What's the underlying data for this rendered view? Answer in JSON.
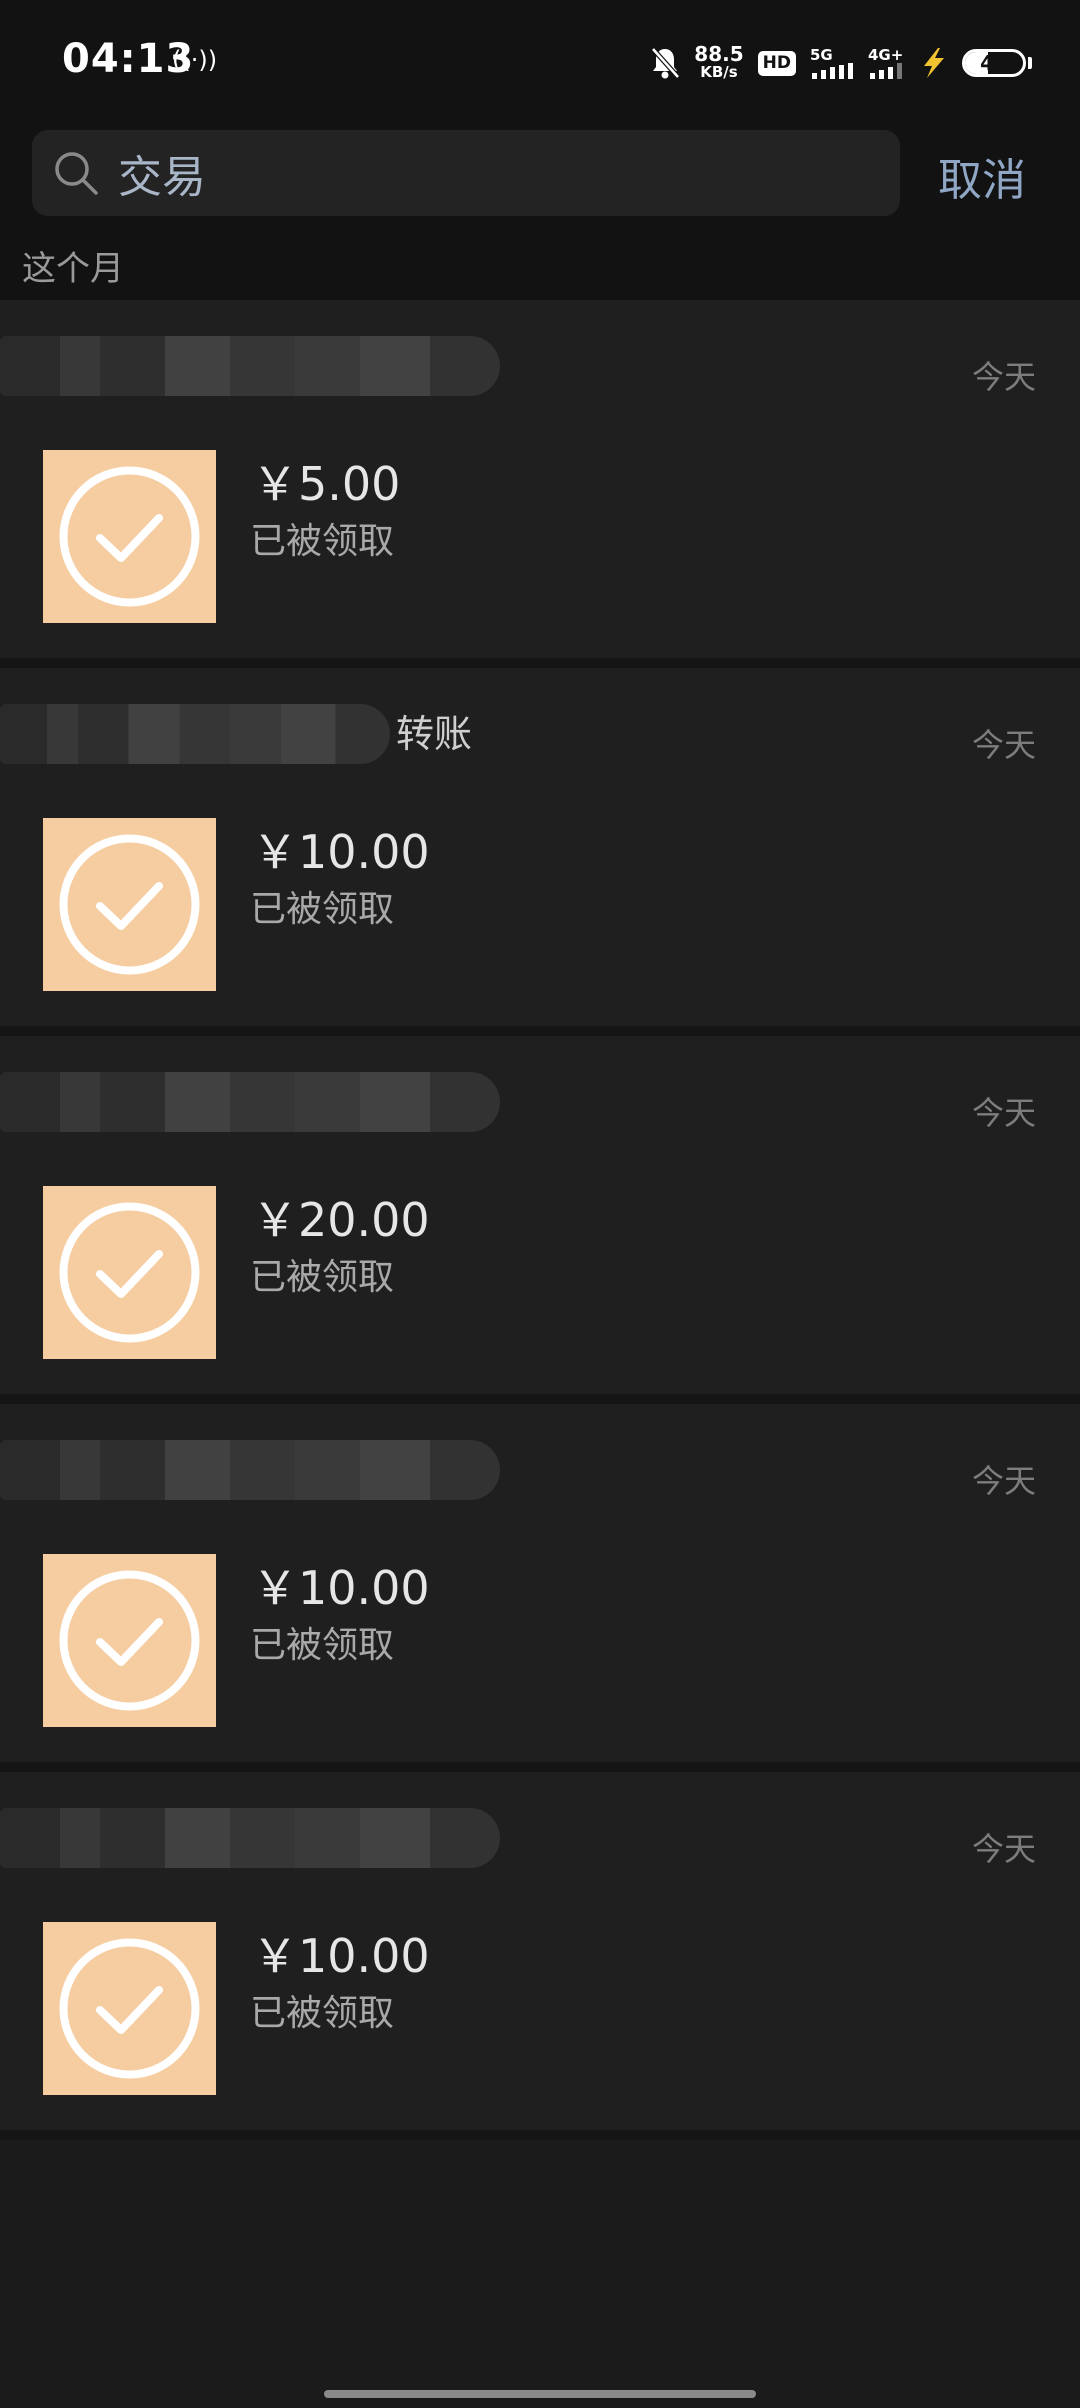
{
  "status_bar": {
    "time": "04:13",
    "net_speed_value": "88.5",
    "net_speed_unit": "KB/s",
    "hd_label": "HD",
    "sim_label": "5G",
    "sim2_label": "4G+",
    "battery_level": "40"
  },
  "search": {
    "query": "交易",
    "cancel_label": "取消"
  },
  "section": {
    "label": "这个月"
  },
  "transactions": [
    {
      "title": "",
      "date": "今天",
      "amount": "￥5.00",
      "status": "已被领取"
    },
    {
      "title": "转账",
      "date": "今天",
      "amount": "￥10.00",
      "status": "已被领取"
    },
    {
      "title": "",
      "date": "今天",
      "amount": "￥20.00",
      "status": "已被领取"
    },
    {
      "title": "",
      "date": "今天",
      "amount": "￥10.00",
      "status": "已被领取"
    },
    {
      "title": "",
      "date": "今天",
      "amount": "￥10.00",
      "status": "已被领取"
    }
  ],
  "colors": {
    "thumb_bg": "#f5cda0",
    "accent_text": "#8fa6c4"
  },
  "icons": {
    "search": "search-icon",
    "received": "check-circle-icon",
    "mute": "bell-off-icon",
    "charging": "lightning-icon"
  }
}
